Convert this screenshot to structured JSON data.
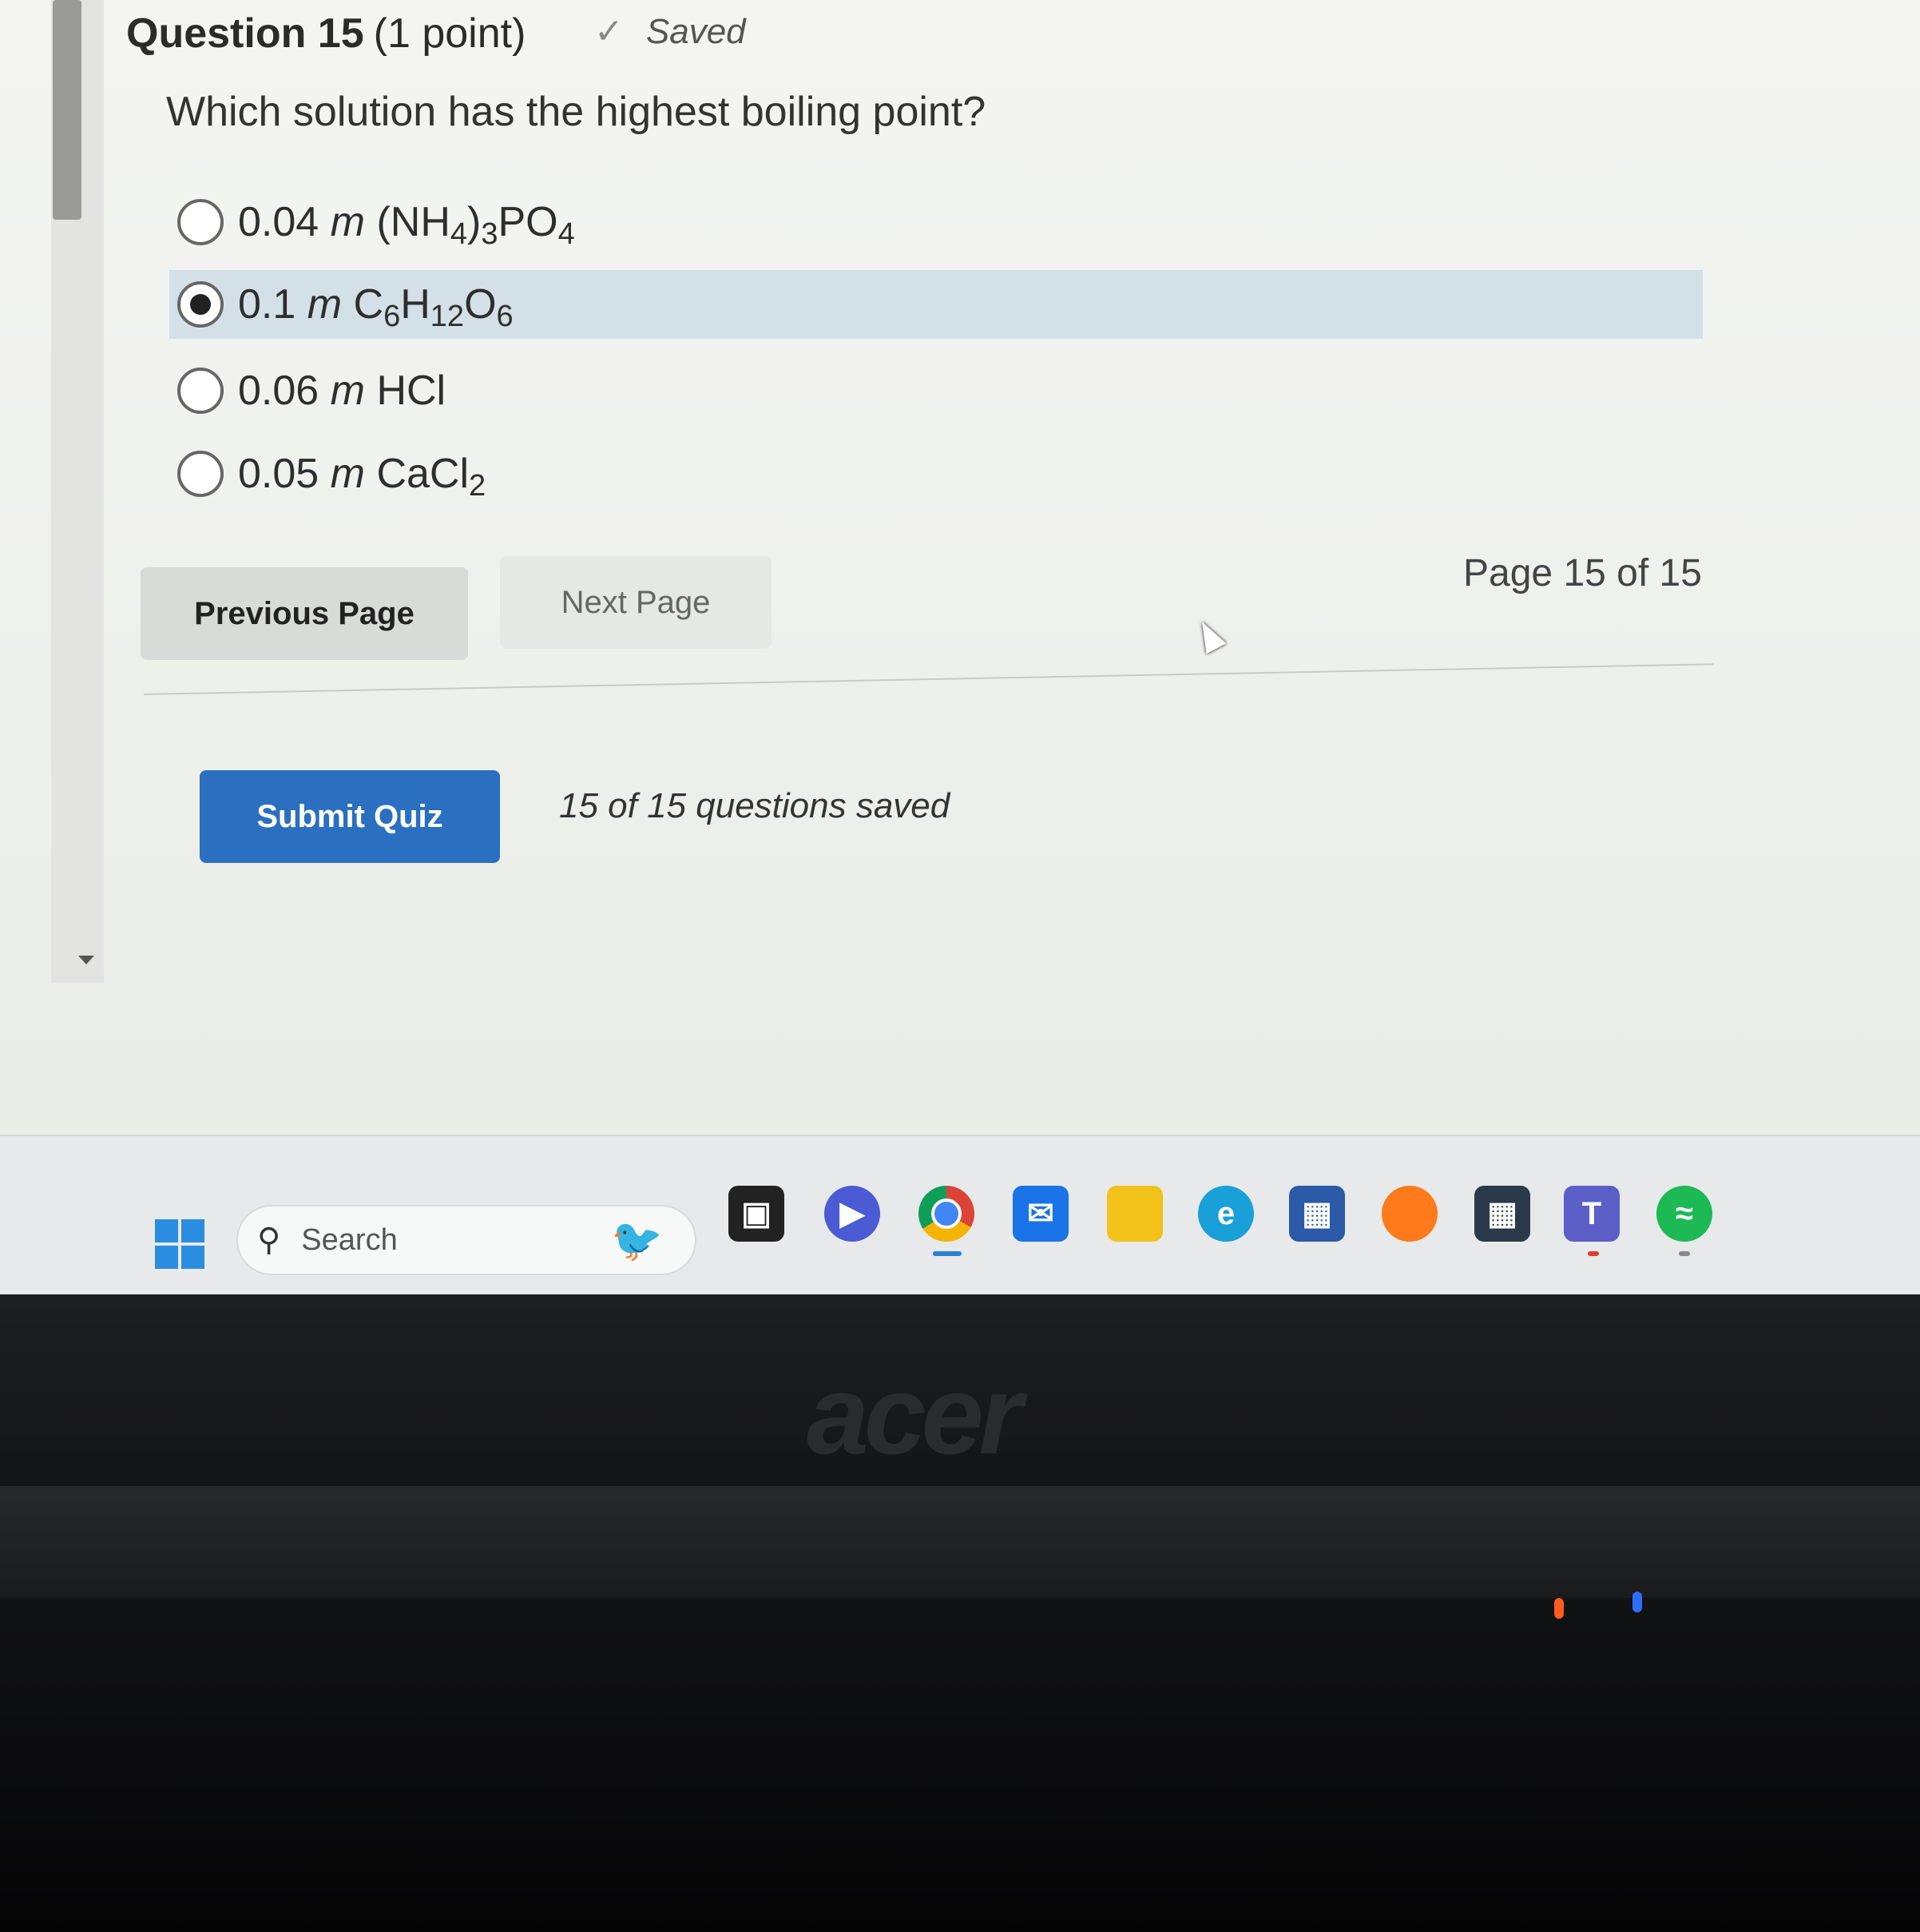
{
  "question": {
    "number_label": "Question 15",
    "points_label": "(1 point)",
    "saved_label": "Saved",
    "prompt": "Which solution has the highest boiling point?"
  },
  "choices": [
    {
      "coef": "0.04",
      "unit": "m",
      "formula_parts": [
        "(NH",
        "4",
        ")",
        "3",
        "PO",
        "4"
      ],
      "selected": false
    },
    {
      "coef": "0.1",
      "unit": "m",
      "formula_parts": [
        "C",
        "6",
        "H",
        "12",
        "O",
        "6"
      ],
      "selected": true
    },
    {
      "coef": "0.06",
      "unit": "m",
      "formula_parts": [
        "HCl"
      ],
      "selected": false
    },
    {
      "coef": "0.05",
      "unit": "m",
      "formula_parts": [
        "CaCl",
        "2"
      ],
      "selected": false
    }
  ],
  "navigation": {
    "previous_label": "Previous Page",
    "next_label": "Next Page",
    "page_indicator": "Page 15 of 15"
  },
  "submit": {
    "button_label": "Submit Quiz",
    "status": "15 of 15 questions saved"
  },
  "taskbar": {
    "search_label": "Search",
    "apps": [
      "windows-start-icon",
      "task-view-icon",
      "chat-icon",
      "chrome-icon",
      "mail-icon",
      "file-explorer-icon",
      "edge-icon",
      "store-icon",
      "firefox-icon",
      "app-icon",
      "teams-icon",
      "spotify-icon"
    ]
  },
  "laptop": {
    "brand": "acer"
  },
  "colors": {
    "submit_button": "#2a6fc0",
    "selected_row": "#d3e0e8"
  }
}
